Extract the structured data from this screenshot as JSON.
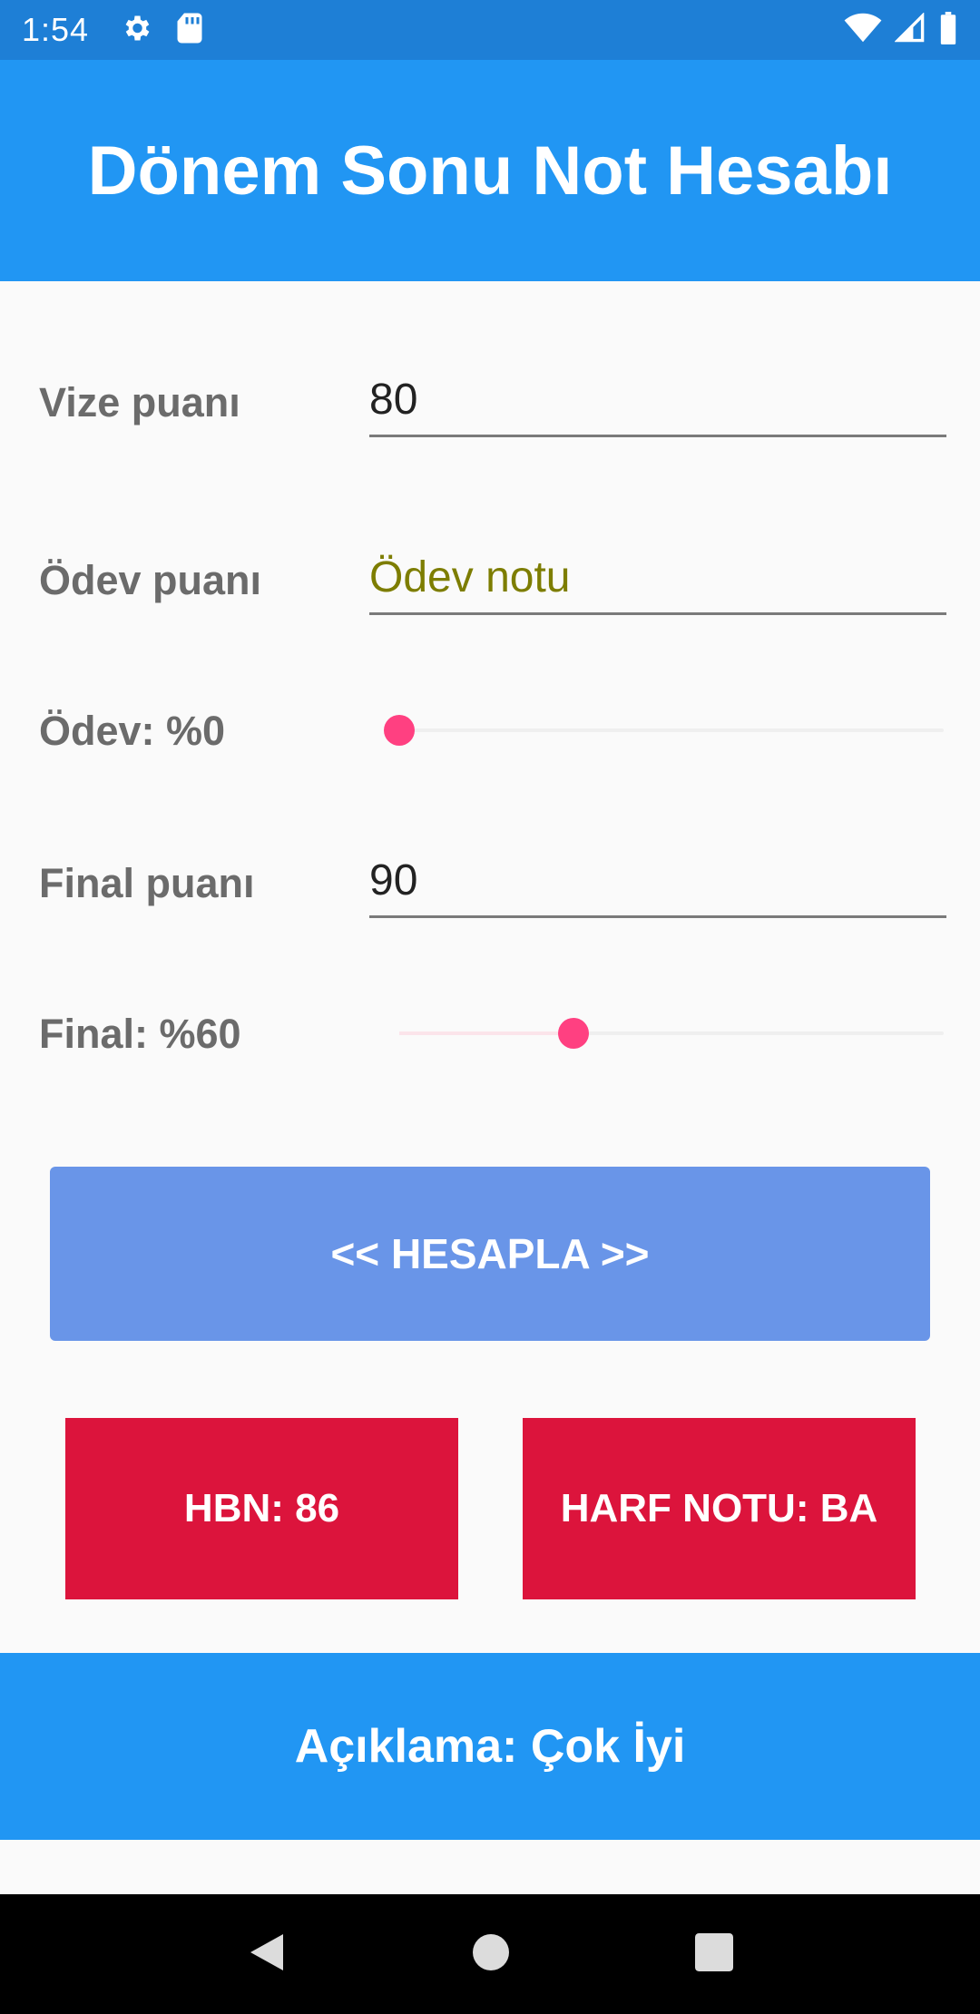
{
  "status_bar": {
    "time": "1:54"
  },
  "app_bar": {
    "title": "Dönem Sonu Not Hesabı"
  },
  "form": {
    "vize": {
      "label": "Vize puanı",
      "value": "80"
    },
    "odev": {
      "label": "Ödev puanı",
      "value": "",
      "placeholder": "Ödev notu"
    },
    "odev_weight": {
      "label": "Ödev: %0",
      "percent": 0
    },
    "final": {
      "label": "Final puanı",
      "value": "90"
    },
    "final_weight": {
      "label": "Final: %60",
      "percent": 60
    }
  },
  "calculate_button": {
    "label": "<< HESAPLA >>"
  },
  "results": {
    "hbn": "HBN: 86",
    "letter_grade": "HARF NOTU: BA"
  },
  "description": "Açıklama: Çok İyi",
  "colors": {
    "accent": "#ff4081",
    "primary": "#2196f3",
    "result": "#dc143c",
    "button": "#6995e8"
  }
}
